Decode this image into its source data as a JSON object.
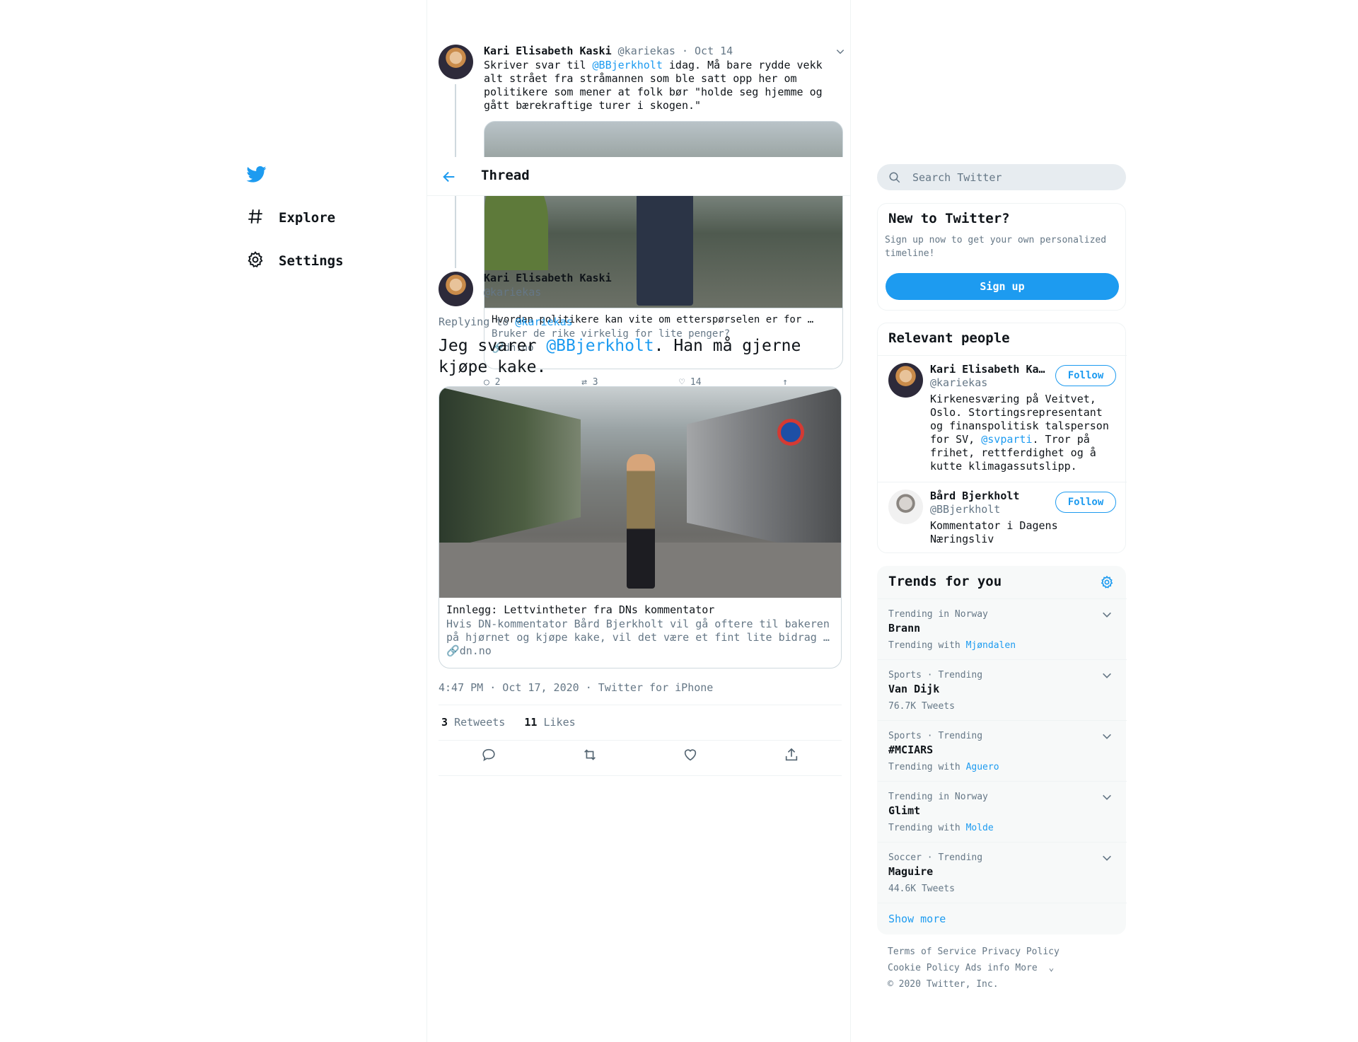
{
  "nav": {
    "items": [
      {
        "label": "Explore",
        "icon": "hashtag-icon"
      },
      {
        "label": "Settings",
        "icon": "gear-icon"
      }
    ]
  },
  "thread_header": {
    "title": "Thread"
  },
  "parent_tweet": {
    "name": "Kari Elisabeth Kaski",
    "handle": "@kariekas",
    "date": "Oct 14",
    "text_before": "Skriver svar til ",
    "mention": "@BBjerkholt",
    "text_after": " idag. Må bare rydde vekk alt strået fra stråmannen som ble satt opp her om politikere som mener at folk bør \"holde seg hjemme og gått bærekraftige turer i skogen.\"",
    "card_title": "Hvordan politikere kan vite om etterspørselen er for …",
    "card_desc": "Bruker de rike virkelig for lite penger?",
    "card_domain": "dn.no",
    "replies": "2",
    "retweets": "3",
    "likes": "14"
  },
  "main_tweet": {
    "name": "Kari Elisabeth Kaski",
    "handle": "@kariekas",
    "replying_prefix": "Replying to ",
    "replying_to": "@kariekas",
    "text_before": "Jeg svarer ",
    "mention": "@BBjerkholt",
    "text_after": ". Han må gjerne kjøpe kake.",
    "card_title": "Innlegg: Lettvintheter fra DNs kommentator",
    "card_desc": "Hvis DN-kommentator Bård Bjerkholt vil gå oftere til bakeren på hjørnet og kjøpe kake, vil det være et fint lite bidrag …",
    "card_domain": "dn.no",
    "time": "4:47 PM · Oct 17, 2020",
    "source": "Twitter for iPhone",
    "retweets_count": "3",
    "retweets_label": "Retweets",
    "likes_count": "11",
    "likes_label": "Likes"
  },
  "search": {
    "placeholder": "Search Twitter"
  },
  "new_to_twitter": {
    "title": "New to Twitter?",
    "text": "Sign up now to get your own personalized timeline!",
    "button": "Sign up"
  },
  "relevant_people": {
    "title": "Relevant people",
    "people": [
      {
        "name": "Kari Elisabeth Ka…",
        "handle": "@kariekas",
        "follow": "Follow",
        "bio_before": "Kirkenesværing på Veitvet, Oslo. Stortingsrepresentant og finanspolitisk talsperson for SV, ",
        "bio_mention": "@svparti",
        "bio_after": ". Tror på frihet, rettferdighet og å kutte klimagassutslipp."
      },
      {
        "name": "Bård Bjerkholt",
        "handle": "@BBjerkholt",
        "follow": "Follow",
        "bio_before": "Kommentator i Dagens Næringsliv",
        "bio_mention": "",
        "bio_after": ""
      }
    ]
  },
  "trends": {
    "title": "Trends for you",
    "items": [
      {
        "context": "Trending in Norway",
        "name": "Brann",
        "sub_prefix": "Trending with ",
        "sub_link": "Mjøndalen"
      },
      {
        "context": "Sports · Trending",
        "name": "Van Dijk",
        "sub_prefix": "76.7K Tweets",
        "sub_link": ""
      },
      {
        "context": "Sports · Trending",
        "name": "#MCIARS",
        "sub_prefix": "Trending with ",
        "sub_link": "Aguero"
      },
      {
        "context": "Trending in Norway",
        "name": "Glimt",
        "sub_prefix": "Trending with ",
        "sub_link": "Molde"
      },
      {
        "context": "Soccer · Trending",
        "name": "Maguire",
        "sub_prefix": "44.6K Tweets",
        "sub_link": ""
      }
    ],
    "show_more": "Show more"
  },
  "footer": {
    "links": [
      "Terms of Service",
      "Privacy Policy",
      "Cookie Policy",
      "Ads info",
      "More"
    ],
    "copyright": "© 2020 Twitter, Inc."
  },
  "colors": {
    "accent": "#1d9bf0",
    "muted": "#657786",
    "text": "#0f1419"
  }
}
